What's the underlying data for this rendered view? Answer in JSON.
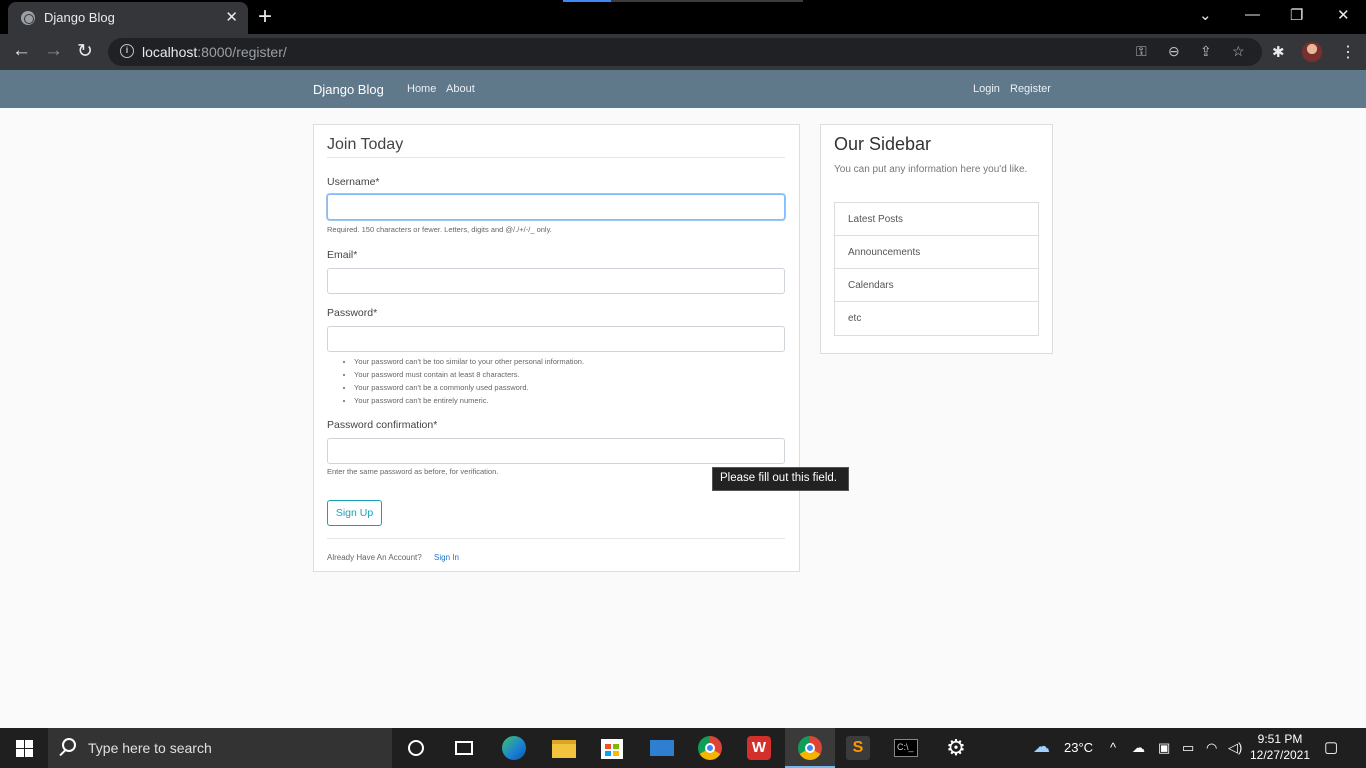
{
  "browser": {
    "tab_title": "Django Blog",
    "tab_close": "✕",
    "new_tab": "+",
    "url_host": "localhost",
    "url_rest": ":8000/register/"
  },
  "site": {
    "brand": "Django Blog",
    "nav_left": [
      "Home",
      "About"
    ],
    "nav_right": [
      "Login",
      "Register"
    ]
  },
  "form": {
    "legend": "Join Today",
    "username_label": "Username*",
    "username_help": "Required. 150 characters or fewer. Letters, digits and @/./+/-/_ only.",
    "email_label": "Email*",
    "password_label": "Password*",
    "password_rules": [
      "Your password can't be too similar to your other personal information.",
      "Your password must contain at least 8 characters.",
      "Your password can't be a commonly used password.",
      "Your password can't be entirely numeric."
    ],
    "password2_label": "Password confirmation*",
    "password2_help": "Enter the same password as before, for verification.",
    "submit_label": "Sign Up",
    "already_text": "Already Have An Account?",
    "signin_label": "Sign In",
    "validation_tooltip": "Please fill out this field."
  },
  "sidebar": {
    "title": "Our Sidebar",
    "text": "You can put any information here you'd like.",
    "items": [
      "Latest Posts",
      "Announcements",
      "Calendars",
      "etc"
    ]
  },
  "taskbar": {
    "search_placeholder": "Type here to search",
    "temperature": "23°C",
    "time": "9:51 PM",
    "date": "12/27/2021"
  }
}
